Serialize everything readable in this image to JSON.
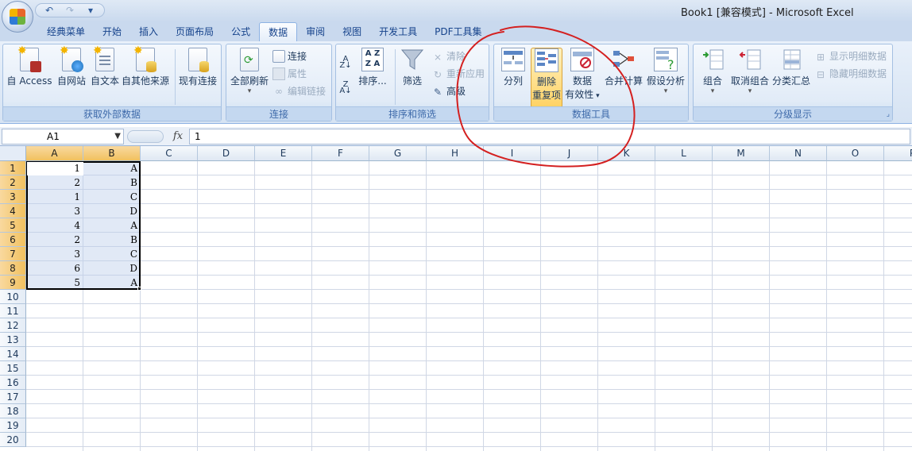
{
  "window": {
    "title": "Book1  [兼容模式] - Microsoft Excel"
  },
  "qat": {
    "undo": "↶",
    "redo": "↷",
    "more": "▾"
  },
  "tabs": [
    "经典菜单",
    "开始",
    "插入",
    "页面布局",
    "公式",
    "数据",
    "审阅",
    "视图",
    "开发工具",
    "PDF工具集"
  ],
  "active_tab": "数据",
  "ribbon": {
    "external": {
      "label": "获取外部数据",
      "access": "自 Access",
      "web": "自网站",
      "text": "自文本",
      "other": "自其他来源",
      "existing": "现有连接"
    },
    "connections": {
      "label": "连接",
      "refresh_all": "全部刷新",
      "connections": "连接",
      "properties": "属性",
      "edit_links": "编辑链接"
    },
    "sort_filter": {
      "label": "排序和筛选",
      "sort": "排序...",
      "filter": "筛选",
      "clear": "清除",
      "reapply": "重新应用",
      "advanced": "高级"
    },
    "data_tools": {
      "label": "数据工具",
      "text_to_columns": "分列",
      "remove_dup_1": "删除",
      "remove_dup_2": "重复项",
      "validation_1": "数据",
      "validation_2": "有效性",
      "consolidate": "合并计算",
      "what_if": "假设分析"
    },
    "outline": {
      "label": "分级显示",
      "group": "组合",
      "ungroup": "取消组合",
      "subtotal": "分类汇总",
      "show_detail": "显示明细数据",
      "hide_detail": "隐藏明细数据"
    }
  },
  "formula_bar": {
    "name_box": "A1",
    "fx": "fx",
    "value": "1"
  },
  "sheet": {
    "columns": [
      "A",
      "B",
      "C",
      "D",
      "E",
      "F",
      "G",
      "H",
      "I",
      "J",
      "K",
      "L",
      "M",
      "N",
      "O",
      "P"
    ],
    "rows": [
      "1",
      "2",
      "3",
      "4",
      "5",
      "6",
      "7",
      "8",
      "9",
      "10",
      "11",
      "12",
      "13",
      "14",
      "15",
      "16",
      "17",
      "18",
      "19",
      "20"
    ],
    "data": [
      [
        "1",
        "A"
      ],
      [
        "2",
        "B"
      ],
      [
        "1",
        "C"
      ],
      [
        "3",
        "D"
      ],
      [
        "4",
        "A"
      ],
      [
        "2",
        "B"
      ],
      [
        "3",
        "C"
      ],
      [
        "6",
        "D"
      ],
      [
        "5",
        "A"
      ]
    ]
  },
  "colors": {
    "annotation": "#d42020",
    "selection_header": "#f1c15f",
    "ribbon": "#d6e3f3"
  }
}
